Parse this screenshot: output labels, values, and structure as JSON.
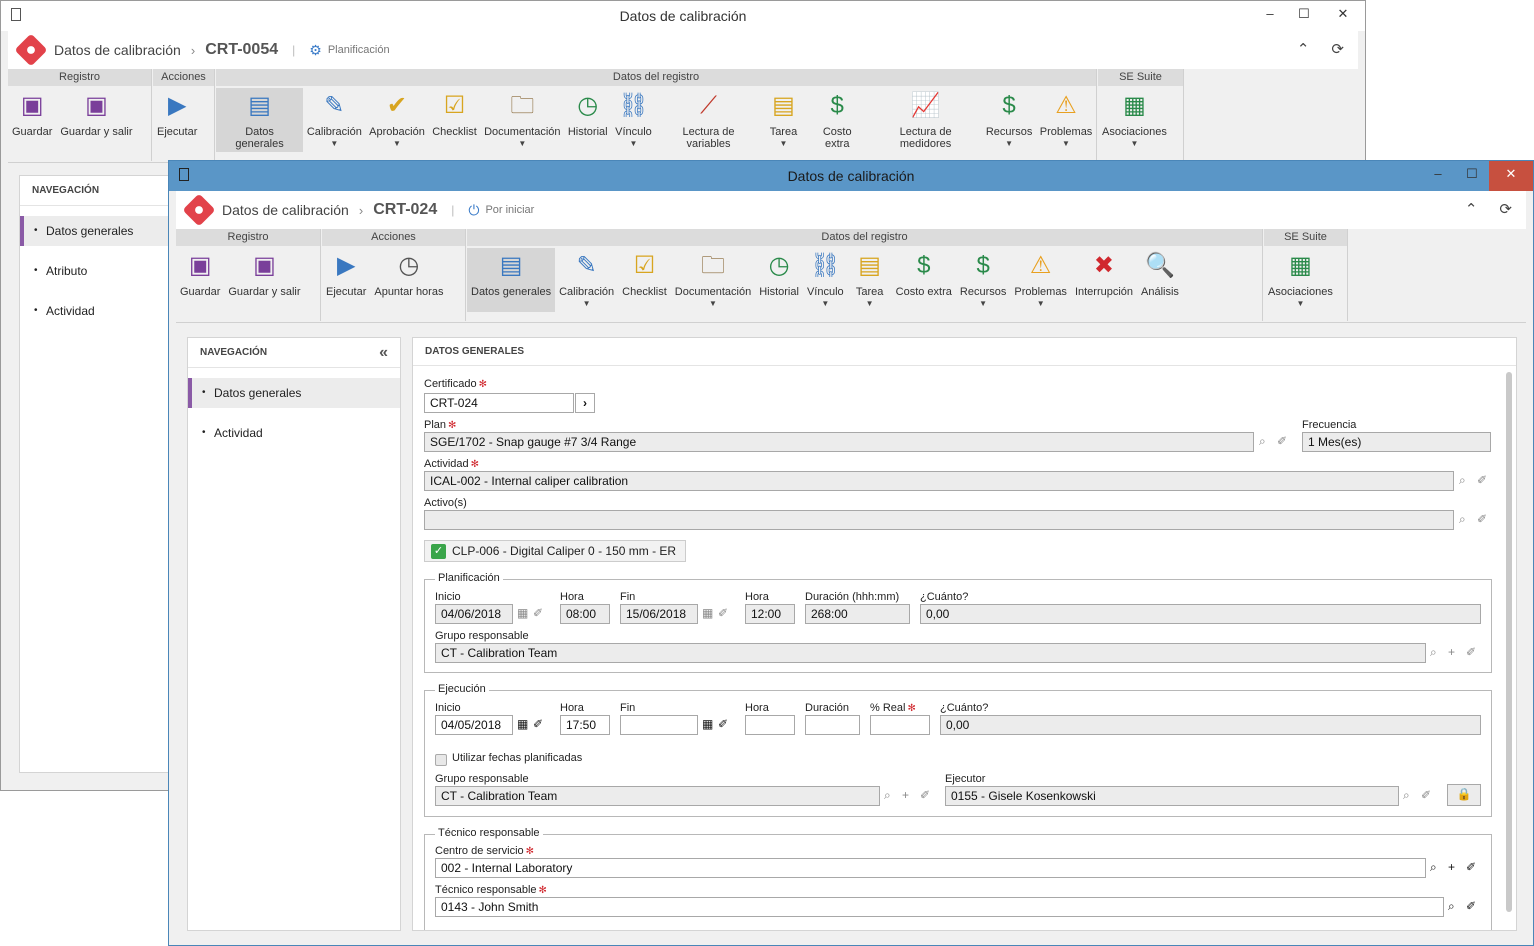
{
  "back_window": {
    "title": "Datos de calibración",
    "app_title": "Datos de calibración",
    "code": "CRT-0054",
    "status": "Planificación",
    "groups": {
      "registro": "Registro",
      "acciones": "Acciones",
      "datos": "Datos del registro",
      "suite": "SE Suite"
    },
    "buttons": [
      "Guardar",
      "Guardar y salir",
      "Ejecutar",
      "Datos generales",
      "Calibración",
      "Aprobación",
      "Checklist",
      "Documentación",
      "Historial",
      "Vínculo",
      "Lectura de variables",
      "Tarea",
      "Costo extra",
      "Lectura de medidores",
      "Recursos",
      "Problemas",
      "Asociaciones"
    ],
    "nav_header": "NAVEGACIÓN",
    "nav_items": [
      "Datos generales",
      "Atributo",
      "Actividad"
    ]
  },
  "front_window": {
    "title": "Datos de calibración",
    "app_title": "Datos de calibración",
    "code": "CRT-024",
    "status": "Por iniciar",
    "groups": {
      "registro": "Registro",
      "acciones": "Acciones",
      "datos": "Datos del registro",
      "suite": "SE Suite"
    },
    "buttons": [
      "Guardar",
      "Guardar y salir",
      "Ejecutar",
      "Apuntar horas",
      "Datos generales",
      "Calibración",
      "Checklist",
      "Documentación",
      "Historial",
      "Vínculo",
      "Tarea",
      "Costo extra",
      "Recursos",
      "Problemas",
      "Interrupción",
      "Análisis",
      "Asociaciones"
    ],
    "nav_header": "NAVEGACIÓN",
    "nav_items": [
      "Datos generales",
      "Actividad"
    ],
    "panel_header": "DATOS GENERALES"
  },
  "form": {
    "certificado_label": "Certificado",
    "certificado": "CRT-024",
    "plan_label": "Plan",
    "plan": "SGE/1702 - Snap gauge #7 3/4 Range",
    "frecuencia_label": "Frecuencia",
    "frecuencia": "1 Mes(es)",
    "actividad_label": "Actividad",
    "actividad": "ICAL-002 - Internal caliper calibration",
    "activos_label": "Activo(s)",
    "activo_chip": "CLP-006 - Digital Caliper 0 - 150 mm - ER",
    "planificacion": {
      "legend": "Planificación",
      "inicio_label": "Inicio",
      "inicio": "04/06/2018",
      "hora_label": "Hora",
      "hora": "08:00",
      "fin_label": "Fin",
      "fin": "15/06/2018",
      "hora_fin_label": "Hora",
      "hora_fin": "12:00",
      "duracion_label": "Duración (hhh:mm)",
      "duracion": "268:00",
      "cuanto_label": "¿Cuánto?",
      "cuanto": "0,00",
      "grupo_label": "Grupo responsable",
      "grupo": "CT - Calibration Team"
    },
    "ejecucion": {
      "legend": "Ejecución",
      "inicio_label": "Inicio",
      "inicio": "04/05/2018",
      "hora_label": "Hora",
      "hora": "17:50",
      "fin_label": "Fin",
      "fin": "",
      "hora_fin_label": "Hora",
      "duracion_label": "Duración",
      "real_label": "% Real",
      "cuanto_label": "¿Cuánto?",
      "cuanto": "0,00",
      "checkbox_label": "Utilizar fechas planificadas",
      "grupo_label": "Grupo responsable",
      "grupo": "CT - Calibration Team",
      "ejecutor_label": "Ejecutor",
      "ejecutor": "0155 - Gisele Kosenkowski"
    },
    "tecnico": {
      "legend": "Técnico responsable",
      "centro_label": "Centro de servicio",
      "centro": "002 - Internal Laboratory",
      "tecnico_label": "Técnico responsable",
      "tecnico": "0143 - John Smith"
    }
  }
}
